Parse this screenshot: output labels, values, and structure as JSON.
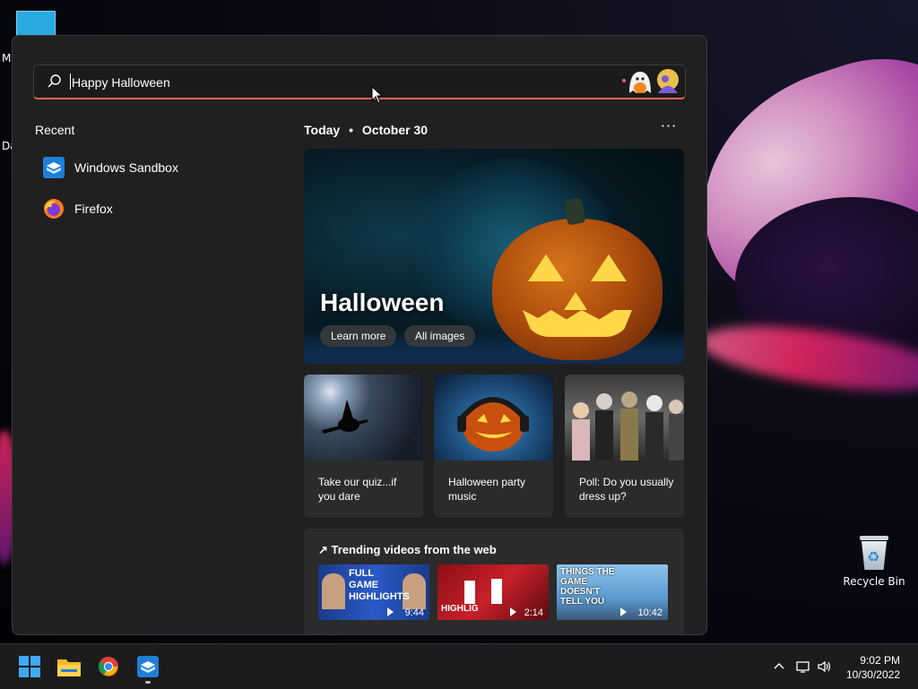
{
  "desktop": {
    "fragment_top": "M",
    "fragment_mid": "Da",
    "recycle_bin_label": "Recycle Bin"
  },
  "start_menu": {
    "search": {
      "value": "Happy Halloween",
      "icon": "search-icon",
      "accent_color": "#e8644e"
    },
    "recent": {
      "title": "Recent",
      "items": [
        {
          "label": "Windows Sandbox",
          "icon": "windows-sandbox-icon"
        },
        {
          "label": "Firefox",
          "icon": "firefox-icon"
        }
      ]
    },
    "today": {
      "label": "Today",
      "separator": "•",
      "date": "October 30",
      "more_label": "···"
    },
    "hero": {
      "title": "Halloween",
      "learn_more": "Learn more",
      "all_images": "All images"
    },
    "cards": [
      {
        "text": "Take our quiz...if you dare"
      },
      {
        "text": "Halloween party music"
      },
      {
        "text": "Poll: Do you usually dress up?"
      }
    ],
    "trending": {
      "title": "Trending videos from the web",
      "videos": [
        {
          "duration": "9:44",
          "caption": "FULL GAME HIGHLIGHTS"
        },
        {
          "duration": "2:14",
          "caption": "HIGHLIG"
        },
        {
          "duration": "10:42",
          "caption": "THINGS THE GAME DOESN'T TELL YOU"
        }
      ]
    }
  },
  "taskbar": {
    "apps": [
      "start-icon",
      "file-explorer-icon",
      "chrome-icon",
      "windows-sandbox-icon"
    ],
    "time": "9:02 PM",
    "date": "10/30/2022"
  }
}
